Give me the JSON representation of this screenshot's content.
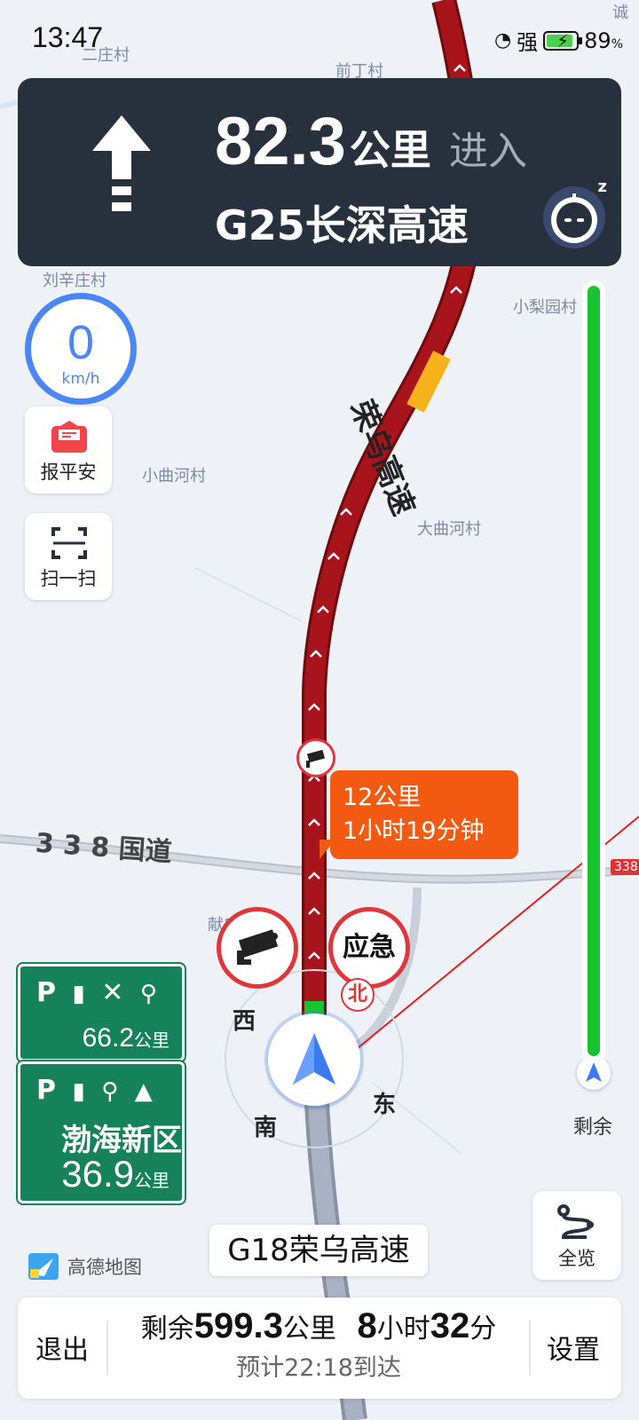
{
  "status": {
    "time": "13:47",
    "signal": "强",
    "battery": "89",
    "battery_unit": "%"
  },
  "guide": {
    "distance": "82.3",
    "distance_unit": "公里",
    "action": "进入",
    "road": "G25长深高速",
    "assistant_badge": "z"
  },
  "speed": {
    "value": "0",
    "unit": "km/h"
  },
  "buttons": {
    "safe_label": "报平安",
    "scan_label": "扫一扫",
    "overview_label": "全览"
  },
  "map": {
    "labels": [
      "前丁村",
      "二庄村",
      "刘辛庄村",
      "小梨园村",
      "小曲河村",
      "大曲河村",
      "献庄村",
      "诚"
    ],
    "highway_label": "荣乌高速",
    "national_road": "3 3 8 国道",
    "road_badge": "338"
  },
  "bubble": {
    "distance": "12公里",
    "time": "1小时19分钟"
  },
  "markers": {
    "emergency": "应急",
    "north": "北"
  },
  "compass": {
    "west": "西",
    "east": "东",
    "south": "南"
  },
  "hw_sign1": {
    "icons": "P  ✕ ",
    "distance": "66.2",
    "unit": "公里"
  },
  "hw_sign2": {
    "icons": "P  ",
    "name": "渤海新区",
    "distance": "36.9",
    "unit": "公里"
  },
  "progress": {
    "remain_label": "剩余"
  },
  "current_road": "G18荣乌高速",
  "brand": "高德地图",
  "bottom": {
    "exit_label": "退出",
    "settings_label": "设置",
    "remain_prefix": "剩余",
    "remain_distance": "599.3",
    "remain_distance_unit": "公里",
    "remain_hours": "8",
    "hours_unit": "小时",
    "remain_minutes": "32",
    "minutes_unit": "分",
    "eta": "预计22:18到达"
  },
  "colors": {
    "route_red": "#a8141b",
    "route_yellow": "#f5b21b",
    "progress_green": "#16c42f",
    "panel": "#27303d",
    "accent_blue": "#4a86f5",
    "bubble_orange": "#f25a12",
    "highway_green": "#168259"
  }
}
